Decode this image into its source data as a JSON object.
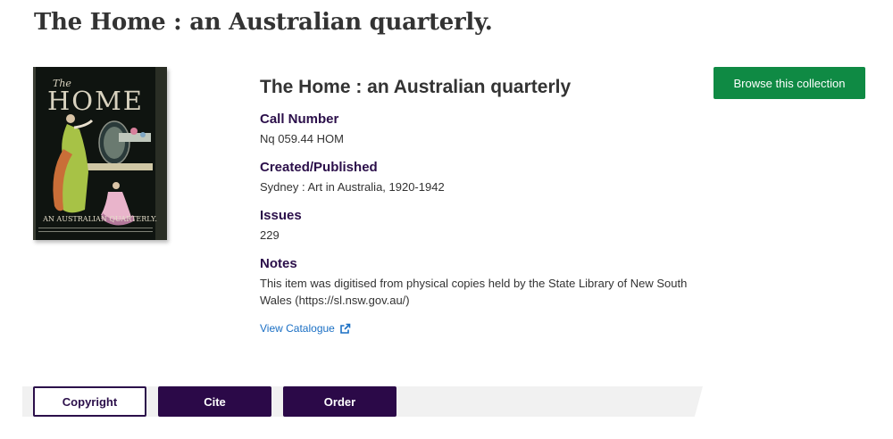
{
  "page": {
    "title": "The Home : an Australian quarterly."
  },
  "cover": {
    "alt": "Cover of The Home",
    "masthead_small": "The",
    "masthead_large": "HOME",
    "subtitle": "AN AUSTRALIAN QUARTERLY."
  },
  "item": {
    "title": "The Home : an Australian quarterly",
    "fields": [
      {
        "label": "Call Number",
        "value": "Nq 059.44 HOM"
      },
      {
        "label": "Created/Published",
        "value": "Sydney : Art in Australia, 1920-1942"
      },
      {
        "label": "Issues",
        "value": "229"
      },
      {
        "label": "Notes",
        "value": "This item was digitised from physical copies held by the State Library of New South Wales (https://sl.nsw.gov.au/)"
      }
    ],
    "catalogue_link": "View Catalogue",
    "catalogue_icon": "external-link-icon"
  },
  "actions": {
    "browse": "Browse this collection",
    "copyright": "Copyright",
    "cite": "Cite",
    "order": "Order"
  },
  "colors": {
    "brand_purple": "#2b0948",
    "browse_green": "#0f8a44",
    "link_blue": "#1a6fc4",
    "label_purple": "#2b0f4a"
  }
}
